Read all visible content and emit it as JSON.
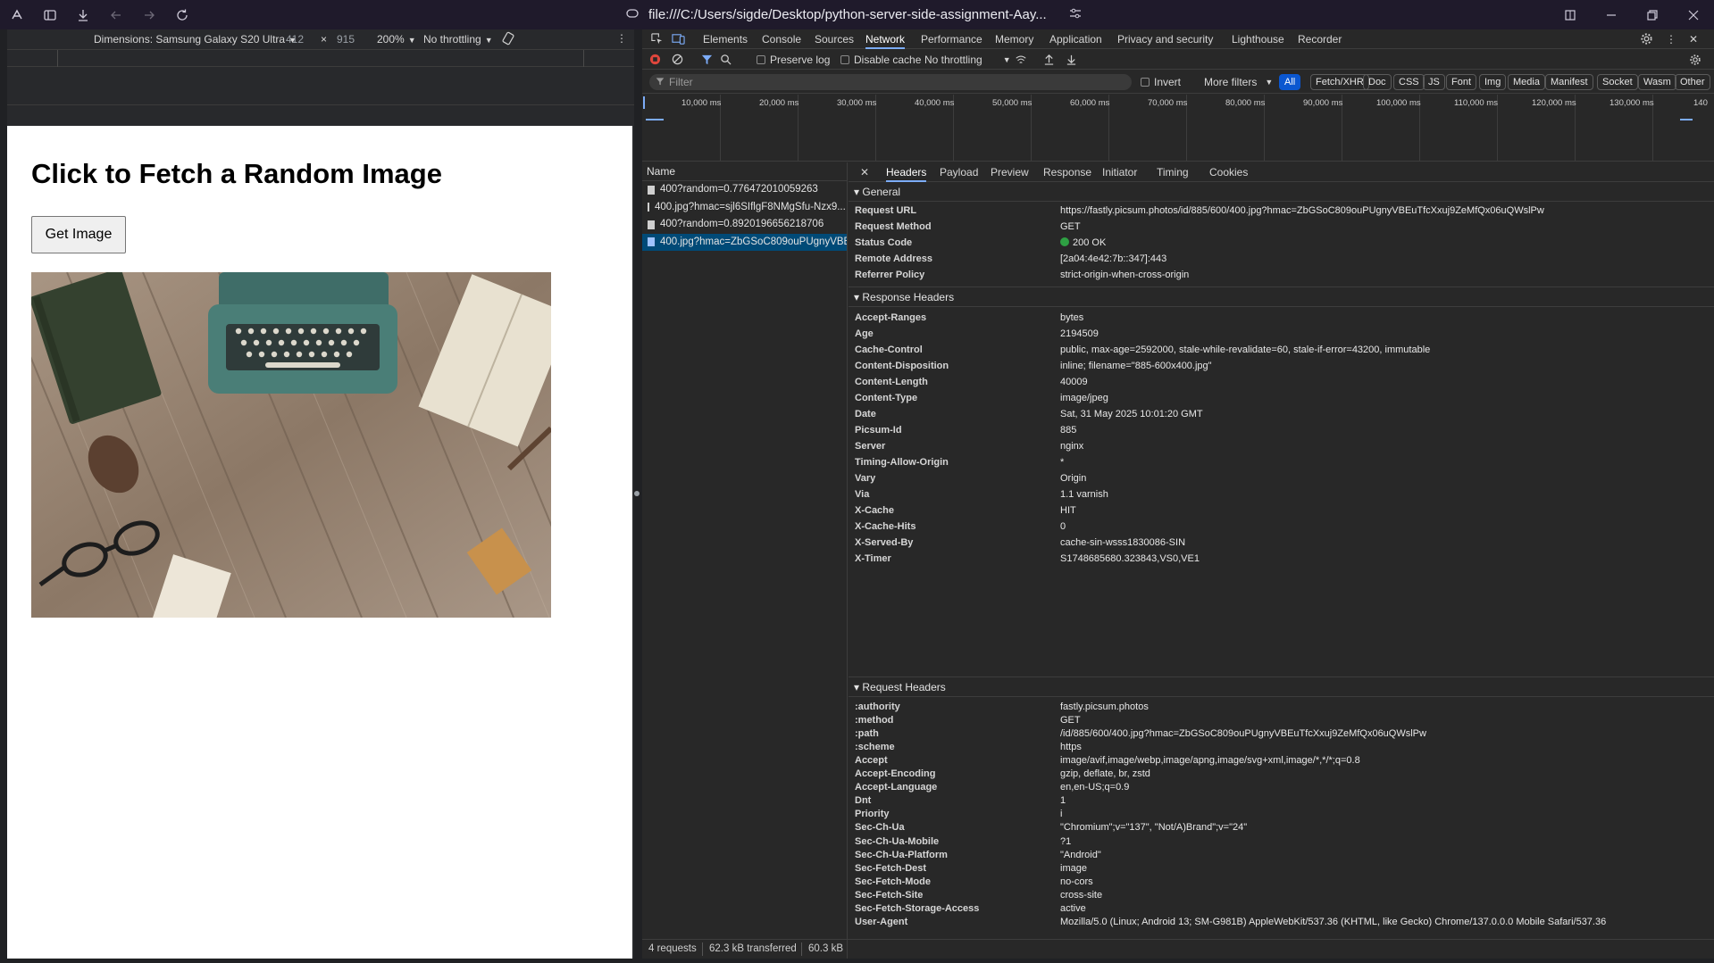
{
  "browser": {
    "url": "file:///C:/Users/sigde/Desktop/python-server-side-assignment-Aay..."
  },
  "device_toolbar": {
    "dimensions_label": "Dimensions: Samsung Galaxy S20 Ultra",
    "width": "412",
    "times": "×",
    "height": "915",
    "zoom": "200%",
    "throttling": "No throttling"
  },
  "page": {
    "heading": "Click to Fetch a Random Image",
    "button_label": "Get Image"
  },
  "devtools": {
    "tabs": [
      "Elements",
      "Console",
      "Sources",
      "Network",
      "Performance",
      "Memory",
      "Application",
      "Privacy and security",
      "Lighthouse",
      "Recorder"
    ],
    "active_tab": "Network",
    "toolbar": {
      "preserve_log": "Preserve log",
      "disable_cache": "Disable cache",
      "throttling": "No throttling"
    },
    "filter": {
      "placeholder": "Filter",
      "invert": "Invert",
      "more_filters": "More filters",
      "chips": [
        "All",
        "Fetch/XHR",
        "Doc",
        "CSS",
        "JS",
        "Font",
        "Img",
        "Media",
        "Manifest",
        "Socket",
        "Wasm",
        "Other"
      ]
    },
    "timeline_labels": [
      "10,000 ms",
      "20,000 ms",
      "30,000 ms",
      "40,000 ms",
      "50,000 ms",
      "60,000 ms",
      "70,000 ms",
      "80,000 ms",
      "90,000 ms",
      "100,000 ms",
      "110,000 ms",
      "120,000 ms",
      "130,000 ms",
      "140"
    ],
    "requests_header": "Name",
    "requests": [
      "400?random=0.776472010059263",
      "400.jpg?hmac=sjl6SIflgF8NMgSfu-Nzx9...",
      "400?random=0.8920196656218706",
      "400.jpg?hmac=ZbGSoC809ouPUgnyVBE..."
    ],
    "summary": {
      "requests": "4 requests",
      "transferred": "62.3 kB transferred",
      "resources": "60.3 kB"
    },
    "detail_tabs": [
      "Headers",
      "Payload",
      "Preview",
      "Response",
      "Initiator",
      "Timing",
      "Cookies"
    ],
    "general": {
      "title": "General",
      "rows": [
        {
          "k": "Request URL",
          "v": "https://fastly.picsum.photos/id/885/600/400.jpg?hmac=ZbGSoC809ouPUgnyVBEuTfcXxuj9ZeMfQx06uQWslPw"
        },
        {
          "k": "Request Method",
          "v": "GET"
        },
        {
          "k": "Status Code",
          "v": "200 OK"
        },
        {
          "k": "Remote Address",
          "v": "[2a04:4e42:7b::347]:443"
        },
        {
          "k": "Referrer Policy",
          "v": "strict-origin-when-cross-origin"
        }
      ]
    },
    "response_headers": {
      "title": "Response Headers",
      "rows": [
        {
          "k": "Accept-Ranges",
          "v": "bytes"
        },
        {
          "k": "Age",
          "v": "2194509"
        },
        {
          "k": "Cache-Control",
          "v": "public, max-age=2592000, stale-while-revalidate=60, stale-if-error=43200, immutable"
        },
        {
          "k": "Content-Disposition",
          "v": "inline; filename=\"885-600x400.jpg\""
        },
        {
          "k": "Content-Length",
          "v": "40009"
        },
        {
          "k": "Content-Type",
          "v": "image/jpeg"
        },
        {
          "k": "Date",
          "v": "Sat, 31 May 2025 10:01:20 GMT"
        },
        {
          "k": "Picsum-Id",
          "v": "885"
        },
        {
          "k": "Server",
          "v": "nginx"
        },
        {
          "k": "Timing-Allow-Origin",
          "v": "*"
        },
        {
          "k": "Vary",
          "v": "Origin"
        },
        {
          "k": "Via",
          "v": "1.1 varnish"
        },
        {
          "k": "X-Cache",
          "v": "HIT"
        },
        {
          "k": "X-Cache-Hits",
          "v": "0"
        },
        {
          "k": "X-Served-By",
          "v": "cache-sin-wsss1830086-SIN"
        },
        {
          "k": "X-Timer",
          "v": "S1748685680.323843,VS0,VE1"
        }
      ]
    },
    "request_headers": {
      "title": "Request Headers",
      "rows": [
        {
          "k": ":authority",
          "v": "fastly.picsum.photos"
        },
        {
          "k": ":method",
          "v": "GET"
        },
        {
          "k": ":path",
          "v": "/id/885/600/400.jpg?hmac=ZbGSoC809ouPUgnyVBEuTfcXxuj9ZeMfQx06uQWslPw"
        },
        {
          "k": ":scheme",
          "v": "https"
        },
        {
          "k": "Accept",
          "v": "image/avif,image/webp,image/apng,image/svg+xml,image/*,*/*;q=0.8"
        },
        {
          "k": "Accept-Encoding",
          "v": "gzip, deflate, br, zstd"
        },
        {
          "k": "Accept-Language",
          "v": "en,en-US;q=0.9"
        },
        {
          "k": "Dnt",
          "v": "1"
        },
        {
          "k": "Priority",
          "v": "i"
        },
        {
          "k": "Sec-Ch-Ua",
          "v": "\"Chromium\";v=\"137\", \"Not/A)Brand\";v=\"24\""
        },
        {
          "k": "Sec-Ch-Ua-Mobile",
          "v": "?1"
        },
        {
          "k": "Sec-Ch-Ua-Platform",
          "v": "\"Android\""
        },
        {
          "k": "Sec-Fetch-Dest",
          "v": "image"
        },
        {
          "k": "Sec-Fetch-Mode",
          "v": "no-cors"
        },
        {
          "k": "Sec-Fetch-Site",
          "v": "cross-site"
        },
        {
          "k": "Sec-Fetch-Storage-Access",
          "v": "active"
        },
        {
          "k": "User-Agent",
          "v": "Mozilla/5.0 (Linux; Android 13; SM-G981B) AppleWebKit/537.36 (KHTML, like Gecko) Chrome/137.0.0.0 Mobile Safari/537.36"
        }
      ]
    }
  },
  "colors": {
    "accent": "#7cacf8",
    "selected_row": "#004a77",
    "status_ok": "#2ea043",
    "record": "#e0463c"
  }
}
